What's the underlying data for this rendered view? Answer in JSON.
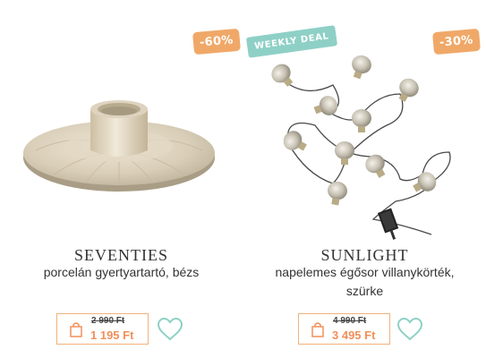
{
  "products": [
    {
      "name": "SEVENTIES",
      "description": "porcelán gyertyartartó, bézs",
      "discount_badge": "-60%",
      "old_price": "2 990 Ft",
      "new_price": "1 195 Ft",
      "image_icon": "candle-holder-image"
    },
    {
      "name": "SUNLIGHT",
      "description": "napelemes égősor villanykörték, szürke",
      "discount_badge": "-30%",
      "promo_badge": "WEEKLY DEAL",
      "old_price": "4 990 Ft",
      "new_price": "3 495 Ft",
      "image_icon": "light-string-image"
    }
  ],
  "colors": {
    "discount_badge": "#f0a868",
    "promo_badge": "#8ed0c6",
    "price_accent": "#f0905a",
    "price_border": "#f0b27a",
    "heart": "#8ed0c6"
  },
  "icons": {
    "cart": "shopping-bag-icon",
    "favorite": "heart-icon"
  }
}
